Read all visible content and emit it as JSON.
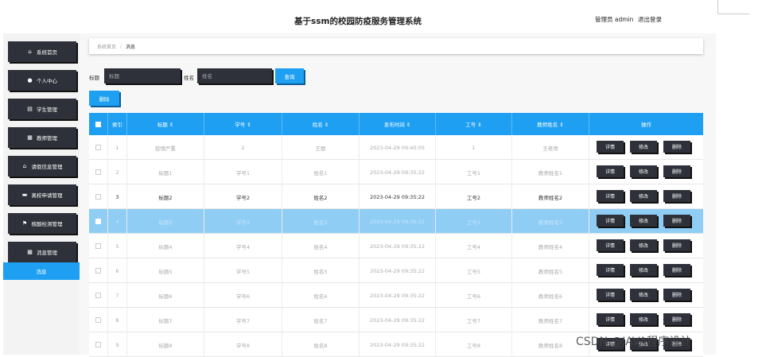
{
  "header": {
    "title": "基于ssm的校园防疫服务管理系统",
    "user": "管理员 admin",
    "logout": "退出登录"
  },
  "sidebar": {
    "items": [
      {
        "label": "系统首页",
        "icon": "home-icon",
        "glyph": "⌂"
      },
      {
        "label": "个人中心",
        "icon": "user-icon",
        "glyph": "●"
      },
      {
        "label": "学生管理",
        "icon": "list-icon",
        "glyph": "▤"
      },
      {
        "label": "教师管理",
        "icon": "grid-icon",
        "glyph": "▦"
      },
      {
        "label": "请假信息管理",
        "icon": "bank-icon",
        "glyph": "⌂"
      },
      {
        "label": "离校申请管理",
        "icon": "card-icon",
        "glyph": "▬"
      },
      {
        "label": "核酸检测管理",
        "icon": "flag-icon",
        "glyph": "⚑"
      },
      {
        "label": "消息管理",
        "icon": "grid-icon",
        "glyph": "▦"
      }
    ],
    "active": "消息"
  },
  "breadcrumb": {
    "home": "系统首页",
    "separator": "/",
    "current": "消息"
  },
  "search": {
    "title_label": "标题",
    "title_placeholder": "标题",
    "name_label": "姓名",
    "name_placeholder": "姓名",
    "query_button": "查询",
    "delete_button": "删除"
  },
  "table": {
    "columns": [
      "",
      "索引",
      "标题 ⇕",
      "学号 ⇕",
      "姓名 ⇕",
      "发布时间 ⇕",
      "工号 ⇕",
      "教师姓名 ⇕",
      "操作"
    ],
    "actions": [
      "详情",
      "修改",
      "删除"
    ],
    "rows": [
      {
        "index": "1",
        "title": "疫情严重",
        "xuehao": "2",
        "name": "王丽",
        "time": "2023-04-29 09:40:05",
        "gonghao": "1",
        "teacher": "王老师"
      },
      {
        "index": "2",
        "title": "标题1",
        "xuehao": "学号1",
        "name": "姓名1",
        "time": "2023-04-29 09:35:22",
        "gonghao": "工号1",
        "teacher": "教师姓名1"
      },
      {
        "index": "3",
        "title": "标题2",
        "xuehao": "学号2",
        "name": "姓名2",
        "time": "2023-04-29 09:35:22",
        "gonghao": "工号2",
        "teacher": "教师姓名2"
      },
      {
        "index": "4",
        "title": "标题3",
        "xuehao": "学号3",
        "name": "姓名3",
        "time": "2023-04-29 09:35:22",
        "gonghao": "工号3",
        "teacher": "教师姓名3"
      },
      {
        "index": "5",
        "title": "标题4",
        "xuehao": "学号4",
        "name": "姓名4",
        "time": "2023-04-29 09:35:22",
        "gonghao": "工号4",
        "teacher": "教师姓名4"
      },
      {
        "index": "6",
        "title": "标题5",
        "xuehao": "学号5",
        "name": "姓名5",
        "time": "2023-04-29 09:35:22",
        "gonghao": "工号5",
        "teacher": "教师姓名5"
      },
      {
        "index": "7",
        "title": "标题6",
        "xuehao": "学号6",
        "name": "姓名6",
        "time": "2023-04-29 09:35:22",
        "gonghao": "工号6",
        "teacher": "教师姓名6"
      },
      {
        "index": "8",
        "title": "标题7",
        "xuehao": "学号7",
        "name": "姓名7",
        "time": "2023-04-29 09:35:22",
        "gonghao": "工号7",
        "teacher": "教师姓名7"
      },
      {
        "index": "9",
        "title": "标题8",
        "xuehao": "学号8",
        "name": "姓名8",
        "time": "2023-04-29 09:35:22",
        "gonghao": "工号8",
        "teacher": "教师姓名8"
      }
    ]
  },
  "watermark": "CSDN @JAVA程序设计",
  "colors": {
    "accent": "#1e9ff2",
    "dark_button": "#2e3139",
    "selected_row": "#8fcdf5"
  }
}
